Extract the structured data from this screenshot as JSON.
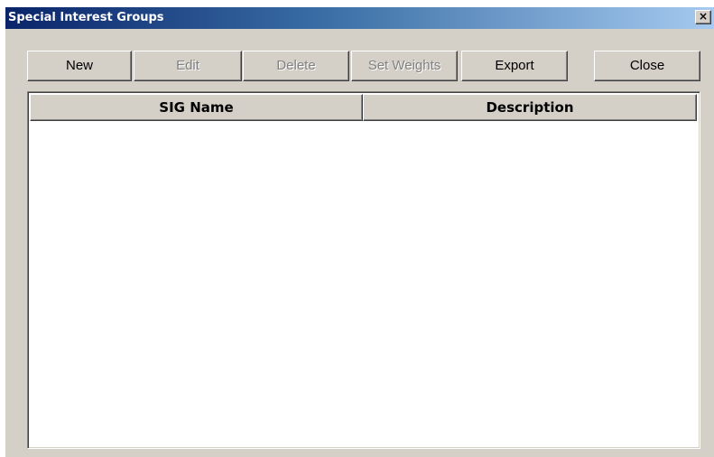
{
  "window": {
    "title": "Special Interest Groups",
    "close_glyph": "×"
  },
  "toolbar": {
    "buttons": [
      {
        "label": "New",
        "enabled": true
      },
      {
        "label": "Edit",
        "enabled": false
      },
      {
        "label": "Delete",
        "enabled": false
      },
      {
        "label": "Set Weights",
        "enabled": false
      },
      {
        "label": "Export",
        "enabled": true
      },
      {
        "label": "Close",
        "enabled": true
      }
    ]
  },
  "table": {
    "columns": [
      "SIG Name",
      "Description"
    ],
    "rows": []
  },
  "colors": {
    "titlebar_start": "#0a246a",
    "titlebar_end": "#a6caf0",
    "face": "#d4d0c8",
    "disabled_text": "#808080"
  }
}
